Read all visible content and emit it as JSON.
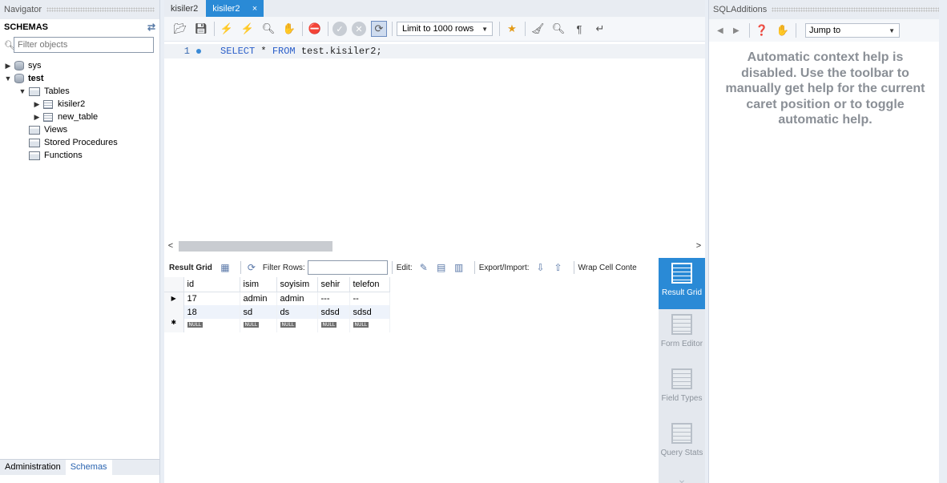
{
  "navigator": {
    "title": "Navigator",
    "schemas_label": "SCHEMAS",
    "filter_placeholder": "Filter objects",
    "tree": {
      "sys": "sys",
      "test": "test",
      "tables": "Tables",
      "kisiler2": "kisiler2",
      "new_table": "new_table",
      "views": "Views",
      "stored_procedures": "Stored Procedures",
      "functions": "Functions"
    },
    "tabs": {
      "administration": "Administration",
      "schemas": "Schemas"
    }
  },
  "editor": {
    "tabs": [
      "kisiler2",
      "kisiler2"
    ],
    "close_glyph": "×",
    "limit": "Limit to 1000 rows",
    "line_number": "1",
    "sql": {
      "kw1": "SELECT",
      "mid": " * ",
      "kw2": "FROM",
      "rest": " test.kisiler2;"
    }
  },
  "result": {
    "grid_label": "Result Grid",
    "filter_rows": "Filter Rows:",
    "edit": "Edit:",
    "export_import": "Export/Import:",
    "wrap": "Wrap Cell Conte",
    "columns": [
      "id",
      "isim",
      "soyisim",
      "sehir",
      "telefon"
    ],
    "rows": [
      [
        "17",
        "admin",
        "admin",
        "---",
        "--"
      ],
      [
        "18",
        "sd",
        "ds",
        "sdsd",
        "sdsd"
      ]
    ],
    "null_label": "NULL"
  },
  "side_panel": {
    "result_grid": "Result Grid",
    "form_editor": "Form Editor",
    "field_types": "Field Types",
    "query_stats": "Query Stats"
  },
  "sql_additions": {
    "title": "SQLAdditions",
    "jump_to": "Jump to",
    "help_text": "Automatic context help is disabled. Use the toolbar to manually get help for the current caret position or to toggle automatic help."
  },
  "colors": {
    "accent": "#2a8ad6",
    "keyword": "#2a5ec9",
    "help_text": "#8a8f96"
  }
}
